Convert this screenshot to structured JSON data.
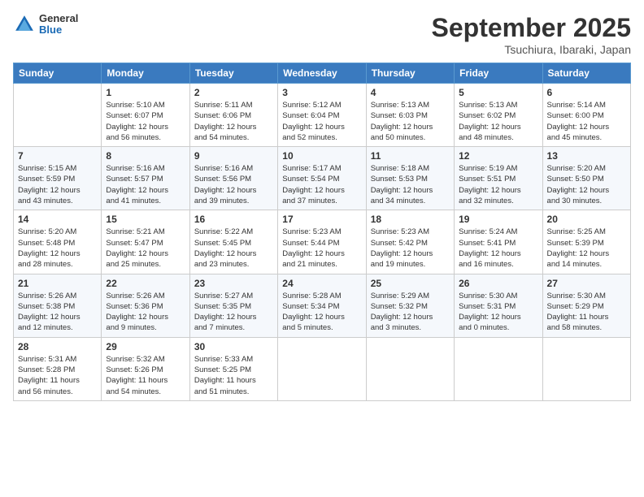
{
  "header": {
    "logo_general": "General",
    "logo_blue": "Blue",
    "month_title": "September 2025",
    "location": "Tsuchiura, Ibaraki, Japan"
  },
  "weekdays": [
    "Sunday",
    "Monday",
    "Tuesday",
    "Wednesday",
    "Thursday",
    "Friday",
    "Saturday"
  ],
  "weeks": [
    [
      {
        "day": "",
        "info": ""
      },
      {
        "day": "1",
        "info": "Sunrise: 5:10 AM\nSunset: 6:07 PM\nDaylight: 12 hours\nand 56 minutes."
      },
      {
        "day": "2",
        "info": "Sunrise: 5:11 AM\nSunset: 6:06 PM\nDaylight: 12 hours\nand 54 minutes."
      },
      {
        "day": "3",
        "info": "Sunrise: 5:12 AM\nSunset: 6:04 PM\nDaylight: 12 hours\nand 52 minutes."
      },
      {
        "day": "4",
        "info": "Sunrise: 5:13 AM\nSunset: 6:03 PM\nDaylight: 12 hours\nand 50 minutes."
      },
      {
        "day": "5",
        "info": "Sunrise: 5:13 AM\nSunset: 6:02 PM\nDaylight: 12 hours\nand 48 minutes."
      },
      {
        "day": "6",
        "info": "Sunrise: 5:14 AM\nSunset: 6:00 PM\nDaylight: 12 hours\nand 45 minutes."
      }
    ],
    [
      {
        "day": "7",
        "info": "Sunrise: 5:15 AM\nSunset: 5:59 PM\nDaylight: 12 hours\nand 43 minutes."
      },
      {
        "day": "8",
        "info": "Sunrise: 5:16 AM\nSunset: 5:57 PM\nDaylight: 12 hours\nand 41 minutes."
      },
      {
        "day": "9",
        "info": "Sunrise: 5:16 AM\nSunset: 5:56 PM\nDaylight: 12 hours\nand 39 minutes."
      },
      {
        "day": "10",
        "info": "Sunrise: 5:17 AM\nSunset: 5:54 PM\nDaylight: 12 hours\nand 37 minutes."
      },
      {
        "day": "11",
        "info": "Sunrise: 5:18 AM\nSunset: 5:53 PM\nDaylight: 12 hours\nand 34 minutes."
      },
      {
        "day": "12",
        "info": "Sunrise: 5:19 AM\nSunset: 5:51 PM\nDaylight: 12 hours\nand 32 minutes."
      },
      {
        "day": "13",
        "info": "Sunrise: 5:20 AM\nSunset: 5:50 PM\nDaylight: 12 hours\nand 30 minutes."
      }
    ],
    [
      {
        "day": "14",
        "info": "Sunrise: 5:20 AM\nSunset: 5:48 PM\nDaylight: 12 hours\nand 28 minutes."
      },
      {
        "day": "15",
        "info": "Sunrise: 5:21 AM\nSunset: 5:47 PM\nDaylight: 12 hours\nand 25 minutes."
      },
      {
        "day": "16",
        "info": "Sunrise: 5:22 AM\nSunset: 5:45 PM\nDaylight: 12 hours\nand 23 minutes."
      },
      {
        "day": "17",
        "info": "Sunrise: 5:23 AM\nSunset: 5:44 PM\nDaylight: 12 hours\nand 21 minutes."
      },
      {
        "day": "18",
        "info": "Sunrise: 5:23 AM\nSunset: 5:42 PM\nDaylight: 12 hours\nand 19 minutes."
      },
      {
        "day": "19",
        "info": "Sunrise: 5:24 AM\nSunset: 5:41 PM\nDaylight: 12 hours\nand 16 minutes."
      },
      {
        "day": "20",
        "info": "Sunrise: 5:25 AM\nSunset: 5:39 PM\nDaylight: 12 hours\nand 14 minutes."
      }
    ],
    [
      {
        "day": "21",
        "info": "Sunrise: 5:26 AM\nSunset: 5:38 PM\nDaylight: 12 hours\nand 12 minutes."
      },
      {
        "day": "22",
        "info": "Sunrise: 5:26 AM\nSunset: 5:36 PM\nDaylight: 12 hours\nand 9 minutes."
      },
      {
        "day": "23",
        "info": "Sunrise: 5:27 AM\nSunset: 5:35 PM\nDaylight: 12 hours\nand 7 minutes."
      },
      {
        "day": "24",
        "info": "Sunrise: 5:28 AM\nSunset: 5:34 PM\nDaylight: 12 hours\nand 5 minutes."
      },
      {
        "day": "25",
        "info": "Sunrise: 5:29 AM\nSunset: 5:32 PM\nDaylight: 12 hours\nand 3 minutes."
      },
      {
        "day": "26",
        "info": "Sunrise: 5:30 AM\nSunset: 5:31 PM\nDaylight: 12 hours\nand 0 minutes."
      },
      {
        "day": "27",
        "info": "Sunrise: 5:30 AM\nSunset: 5:29 PM\nDaylight: 11 hours\nand 58 minutes."
      }
    ],
    [
      {
        "day": "28",
        "info": "Sunrise: 5:31 AM\nSunset: 5:28 PM\nDaylight: 11 hours\nand 56 minutes."
      },
      {
        "day": "29",
        "info": "Sunrise: 5:32 AM\nSunset: 5:26 PM\nDaylight: 11 hours\nand 54 minutes."
      },
      {
        "day": "30",
        "info": "Sunrise: 5:33 AM\nSunset: 5:25 PM\nDaylight: 11 hours\nand 51 minutes."
      },
      {
        "day": "",
        "info": ""
      },
      {
        "day": "",
        "info": ""
      },
      {
        "day": "",
        "info": ""
      },
      {
        "day": "",
        "info": ""
      }
    ]
  ]
}
